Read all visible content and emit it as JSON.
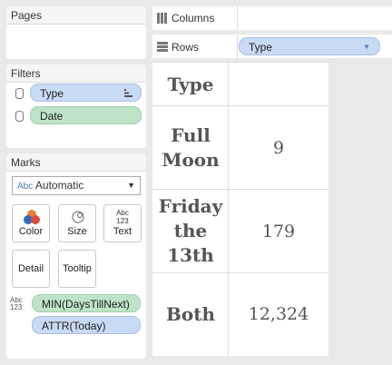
{
  "pages": {
    "title": "Pages"
  },
  "columns_shelf": {
    "label": "Columns"
  },
  "rows_shelf": {
    "label": "Rows",
    "pill": "Type"
  },
  "filters": {
    "title": "Filters",
    "items": [
      {
        "label": "Type"
      },
      {
        "label": "Date"
      }
    ]
  },
  "marks": {
    "title": "Marks",
    "type_prefix": "Abc",
    "mark_type": "Automatic",
    "buttons": {
      "color": "Color",
      "size": "Size",
      "text": "Text",
      "detail": "Detail",
      "tooltip": "Tooltip"
    },
    "text_icon_top": "Abc",
    "text_icon_bottom": "123",
    "fields": [
      {
        "label": "MIN(DaysTillNext)"
      },
      {
        "label": "ATTR(Today)"
      }
    ]
  },
  "table": {
    "header": "Type",
    "rows": [
      {
        "type_line1": "Full",
        "type_line2": "Moon",
        "type_line3": "",
        "value": "9"
      },
      {
        "type_line1": "Friday",
        "type_line2": "the",
        "type_line3": "13th",
        "value": "179"
      },
      {
        "type_line1": "Both",
        "type_line2": "",
        "type_line3": "",
        "value": "12,324"
      }
    ]
  }
}
